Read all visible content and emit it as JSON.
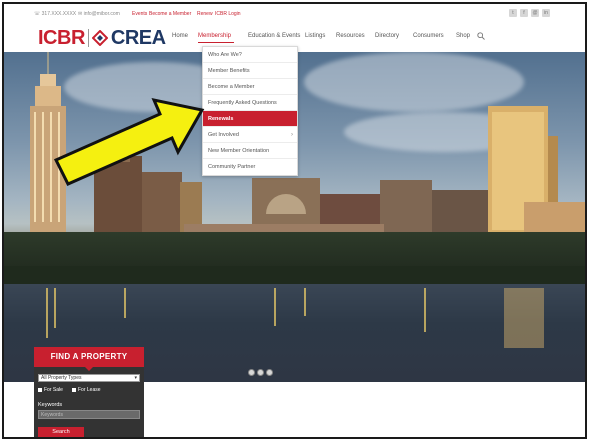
{
  "utility": {
    "phone": "317.XXX.XXXX",
    "email": "info@mibor.com",
    "links": [
      "Events",
      "Become a Member",
      "Renew",
      "ICBR Login"
    ],
    "social": [
      "twitter-icon",
      "facebook-icon",
      "email-icon",
      "linkedin-icon"
    ]
  },
  "logo": {
    "left": "ICBR",
    "right": "CREA"
  },
  "nav": {
    "items": [
      "Home",
      "Membership",
      "Education & Events",
      "Listings",
      "Resources",
      "Directory",
      "Consumers",
      "Shop"
    ],
    "active": "Membership",
    "search_icon": "search-icon"
  },
  "dropdown": {
    "items": [
      "Who Are We?",
      "Member Benefits",
      "Become a Member",
      "Frequently Asked Questions",
      "Renewals",
      "Get Involved",
      "New Member Orientation",
      "Community Partner"
    ],
    "selected": "Renewals",
    "has_submenu": [
      "Get Involved"
    ]
  },
  "annotation": {
    "type": "yellow-arrow",
    "color": "#f5f010",
    "outline": "#111111"
  },
  "carousel": {
    "dots": 3
  },
  "find_property": {
    "title": "FIND A PROPERTY",
    "type_select": "All Property Types",
    "options": [
      "For Sale",
      "For Lease"
    ],
    "keywords_label": "Keywords",
    "keywords_placeholder": "Keywords",
    "search_button": "Search"
  },
  "colors": {
    "brand_red": "#c8202f",
    "brand_navy": "#1f3864",
    "panel_dark": "#333333"
  }
}
